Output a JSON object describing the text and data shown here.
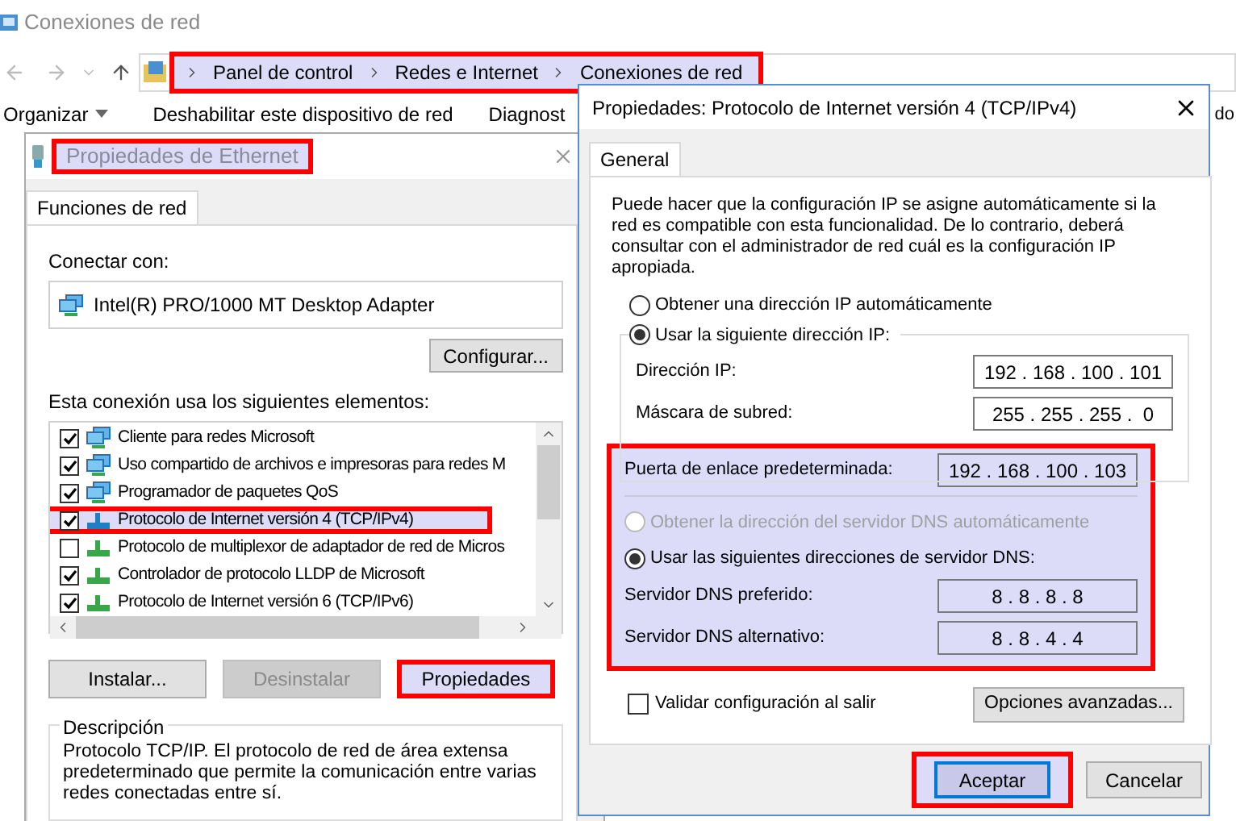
{
  "explorer": {
    "title": "Conexiones de red",
    "breadcrumb": {
      "highlighted": true,
      "items": [
        "Panel de control",
        "Redes e Internet",
        "Conexiones de red"
      ]
    },
    "toolbar": [
      "Organizar",
      "Deshabilitar este dispositivo de red",
      "Diagnost",
      "do"
    ]
  },
  "ethernet_dialog": {
    "title": "Propiedades de Ethernet",
    "title_highlighted": true,
    "tabs": [
      {
        "label": "Funciones de red",
        "selected": true
      }
    ],
    "connect_label": "Conectar con:",
    "adapter": "Intel(R) PRO/1000 MT Desktop Adapter",
    "configure_button": "Configurar...",
    "items_label": "Esta conexión usa los siguientes elementos:",
    "items": [
      {
        "kind": "service",
        "label": "Cliente para redes Microsoft",
        "checked": true,
        "selected": false
      },
      {
        "kind": "service",
        "label": "Uso compartido de archivos e impresoras para redes M",
        "checked": true,
        "selected": false
      },
      {
        "kind": "service",
        "label": "Programador de paquetes QoS",
        "checked": true,
        "selected": false
      },
      {
        "kind": "protocol",
        "label": "Protocolo de Internet versión 4 (TCP/IPv4)",
        "checked": true,
        "selected": true
      },
      {
        "kind": "protocol",
        "label": "Protocolo de multiplexor de adaptador de red de Micros",
        "checked": false,
        "selected": false
      },
      {
        "kind": "protocol",
        "label": "Controlador de protocolo LLDP de Microsoft",
        "checked": true,
        "selected": false
      },
      {
        "kind": "protocol",
        "label": "Protocolo de Internet versión 6 (TCP/IPv6)",
        "checked": true,
        "selected": false
      }
    ],
    "buttons": [
      {
        "label": "Instalar...",
        "disabled": false,
        "highlighted": false
      },
      {
        "label": "Desinstalar",
        "disabled": true,
        "highlighted": false
      },
      {
        "label": "Propiedades",
        "disabled": false,
        "highlighted": true
      }
    ],
    "description": {
      "title": "Descripción",
      "text": "Protocolo TCP/IP. El protocolo de red de área extensa predeterminado que permite la comunicación entre varias redes conectadas entre sí."
    }
  },
  "ipv4_dialog": {
    "title": "Propiedades: Protocolo de Internet versión 4 (TCP/IPv4)",
    "tabs": [
      {
        "label": "General",
        "selected": true
      }
    ],
    "intro": "Puede hacer que la configuración IP se asigne automáticamente si la red es compatible con esta funcionalidad. De lo contrario, deberá consultar con el administrador de red cuál es la configuración IP apropiada.",
    "ip_options": [
      {
        "label": "Obtener una dirección IP automáticamente",
        "selected": false,
        "disabled": false
      },
      {
        "label": "Usar la siguiente dirección IP:",
        "selected": true,
        "disabled": false
      }
    ],
    "ip_fields": [
      {
        "label": "Dirección IP:",
        "value": "192 . 168 . 100 . 101"
      },
      {
        "label": "Máscara de subred:",
        "value": "255 . 255 . 255 .  0"
      },
      {
        "label": "Puerta de enlace predeterminada:",
        "value": "192 . 168 . 100 . 103"
      }
    ],
    "dns_options": [
      {
        "label": "Obtener la dirección del servidor DNS automáticamente",
        "selected": false,
        "disabled": true
      },
      {
        "label": "Usar las siguientes direcciones de servidor DNS:",
        "selected": true,
        "disabled": false
      }
    ],
    "dns_fields": [
      {
        "label": "Servidor DNS preferido:",
        "value": "8 . 8 . 8 . 8"
      },
      {
        "label": "Servidor DNS alternativo:",
        "value": "8 . 8 . 4 . 4"
      }
    ],
    "validate": {
      "label": "Validar configuración al salir",
      "checked": false
    },
    "advanced_button": "Opciones avanzadas...",
    "buttons": [
      {
        "label": "Aceptar",
        "default": true,
        "highlighted": true
      },
      {
        "label": "Cancelar",
        "default": false,
        "highlighted": false
      }
    ]
  }
}
